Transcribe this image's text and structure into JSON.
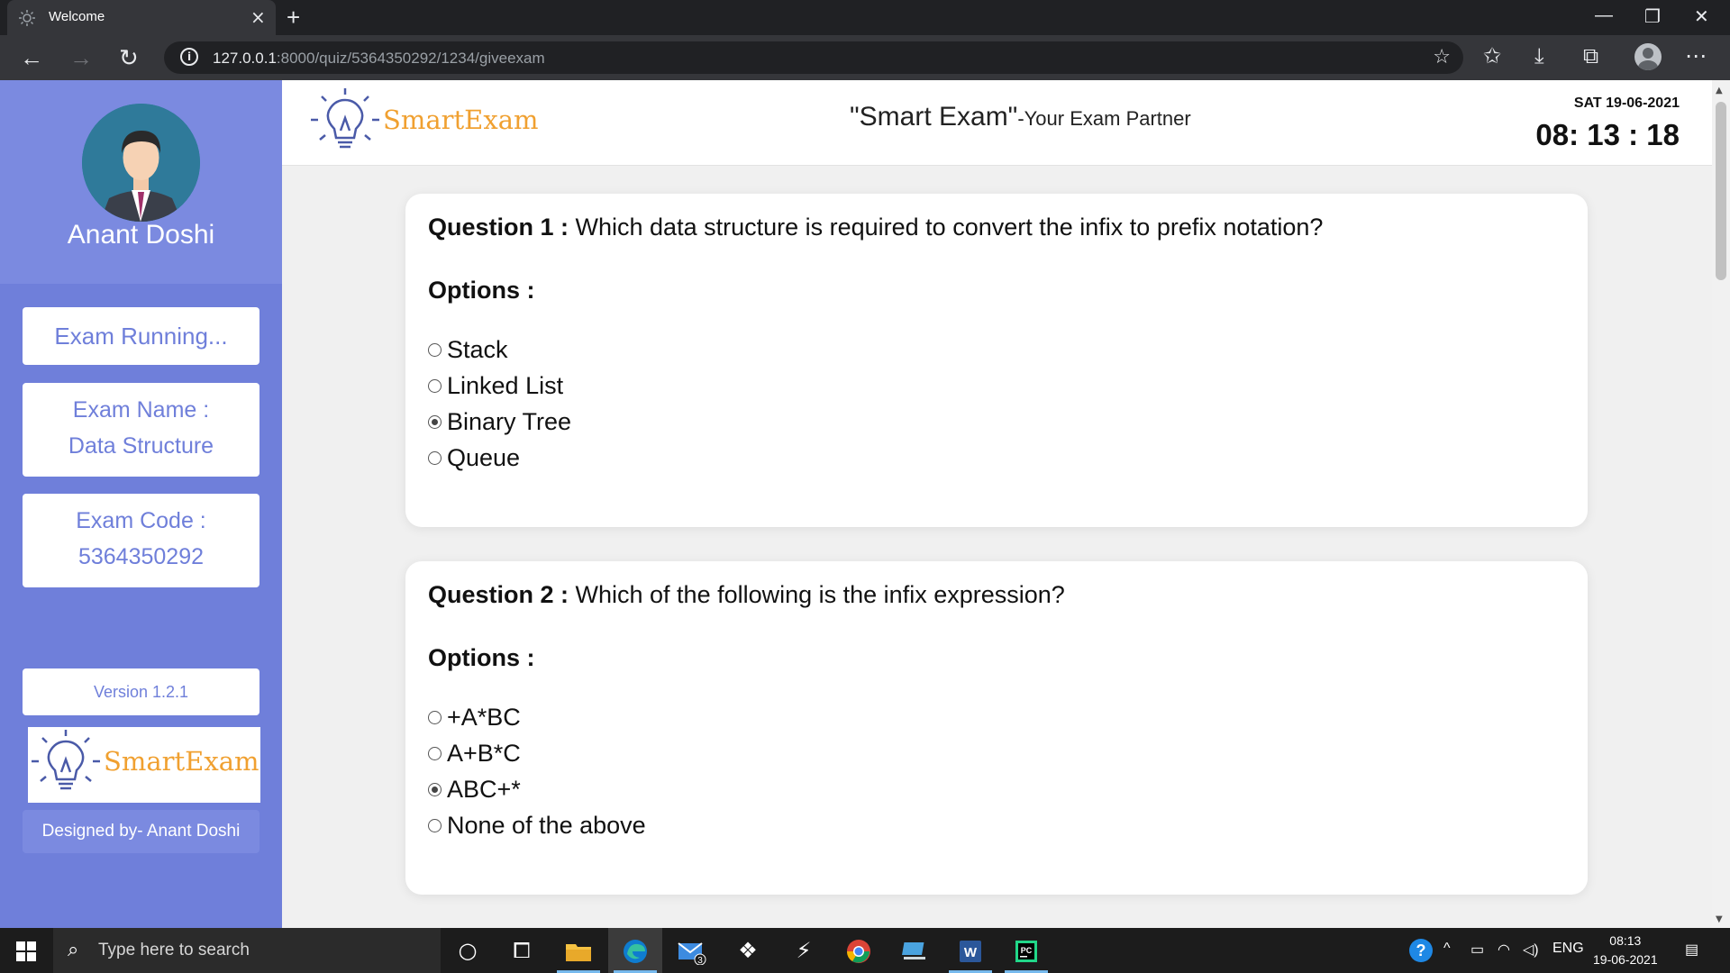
{
  "browser": {
    "tab_title": "Welcome",
    "tab_close": "×",
    "new_tab": "+",
    "url_host": "127.0.0.1",
    "url_rest": ":8000/quiz/5364350292/1234/giveexam",
    "window_controls": {
      "minimize": "—",
      "restore": "❐",
      "close": "✕"
    },
    "icons": [
      "back-icon",
      "forward-icon",
      "reload-icon",
      "info-icon",
      "add-favorite-icon",
      "favorites-icon",
      "downloads-icon",
      "collections-icon",
      "profile-icon",
      "more-icon"
    ]
  },
  "sidebar": {
    "user_name": "Anant Doshi",
    "status": "Exam Running...",
    "exam_name_label": "Exam Name :",
    "exam_name": "Data Structure",
    "exam_code_label": "Exam Code :",
    "exam_code": "5364350292",
    "version": "Version 1.2.1",
    "logo_text": "SmartExam",
    "designed_by": "Designed by- Anant Doshi"
  },
  "header": {
    "logo_text": "SmartExam",
    "title": "\"Smart Exam\"",
    "subtitle": "-Your Exam Partner",
    "date": "SAT 19-06-2021",
    "clock": "08: 13 : 18"
  },
  "questions": [
    {
      "label": "Question 1 :",
      "text": " Which data structure is required to convert the infix to prefix notation?",
      "options_label": "Options :",
      "options": [
        "Stack",
        "Linked List",
        "Binary Tree",
        "Queue"
      ],
      "selected_index": 2
    },
    {
      "label": "Question 2 :",
      "text": " Which of the following is the infix expression?",
      "options_label": "Options :",
      "options": [
        "+A*BC",
        "A+B*C",
        "ABC+*",
        "None of the above"
      ],
      "selected_index": 2
    }
  ],
  "taskbar": {
    "search_placeholder": "Type here to search",
    "mail_badge": "3",
    "language": "ENG",
    "time": "08:13",
    "date": "19-06-2021",
    "apps": [
      "cortana-icon",
      "task-view-icon",
      "file-explorer-icon",
      "edge-icon",
      "mail-icon",
      "dropbox-icon",
      "app-icon",
      "chrome-icon",
      "pc-icon",
      "word-icon",
      "pycharm-icon"
    ]
  },
  "colors": {
    "sidebar": "#6f7fda",
    "sidebar_top": "#7b8ae0",
    "logo_orange": "#f0a030",
    "logo_blue": "#4a5aa8",
    "edge_blue": "#0f7ccf"
  }
}
